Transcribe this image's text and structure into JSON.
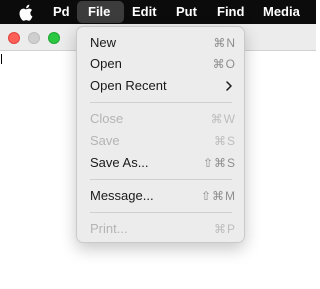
{
  "menubar": {
    "apple_icon": "apple-logo-icon",
    "items": [
      "Pd",
      "File",
      "Edit",
      "Put",
      "Find",
      "Media"
    ]
  },
  "window": {
    "traffic_lights": [
      "close",
      "minimize",
      "zoom"
    ]
  },
  "file_menu": {
    "new": {
      "label": "New",
      "shortcut": "⌘N"
    },
    "open": {
      "label": "Open",
      "shortcut": "⌘O"
    },
    "open_recent": {
      "label": "Open Recent",
      "submenu_icon": "chevron-right-icon"
    },
    "close": {
      "label": "Close",
      "shortcut": "⌘W"
    },
    "save": {
      "label": "Save",
      "shortcut": "⌘S"
    },
    "save_as": {
      "label": "Save As...",
      "shortcut": "⇧⌘S"
    },
    "message": {
      "label": "Message...",
      "shortcut": "⇧⌘M"
    },
    "print": {
      "label": "Print...",
      "shortcut": "⌘P"
    }
  }
}
